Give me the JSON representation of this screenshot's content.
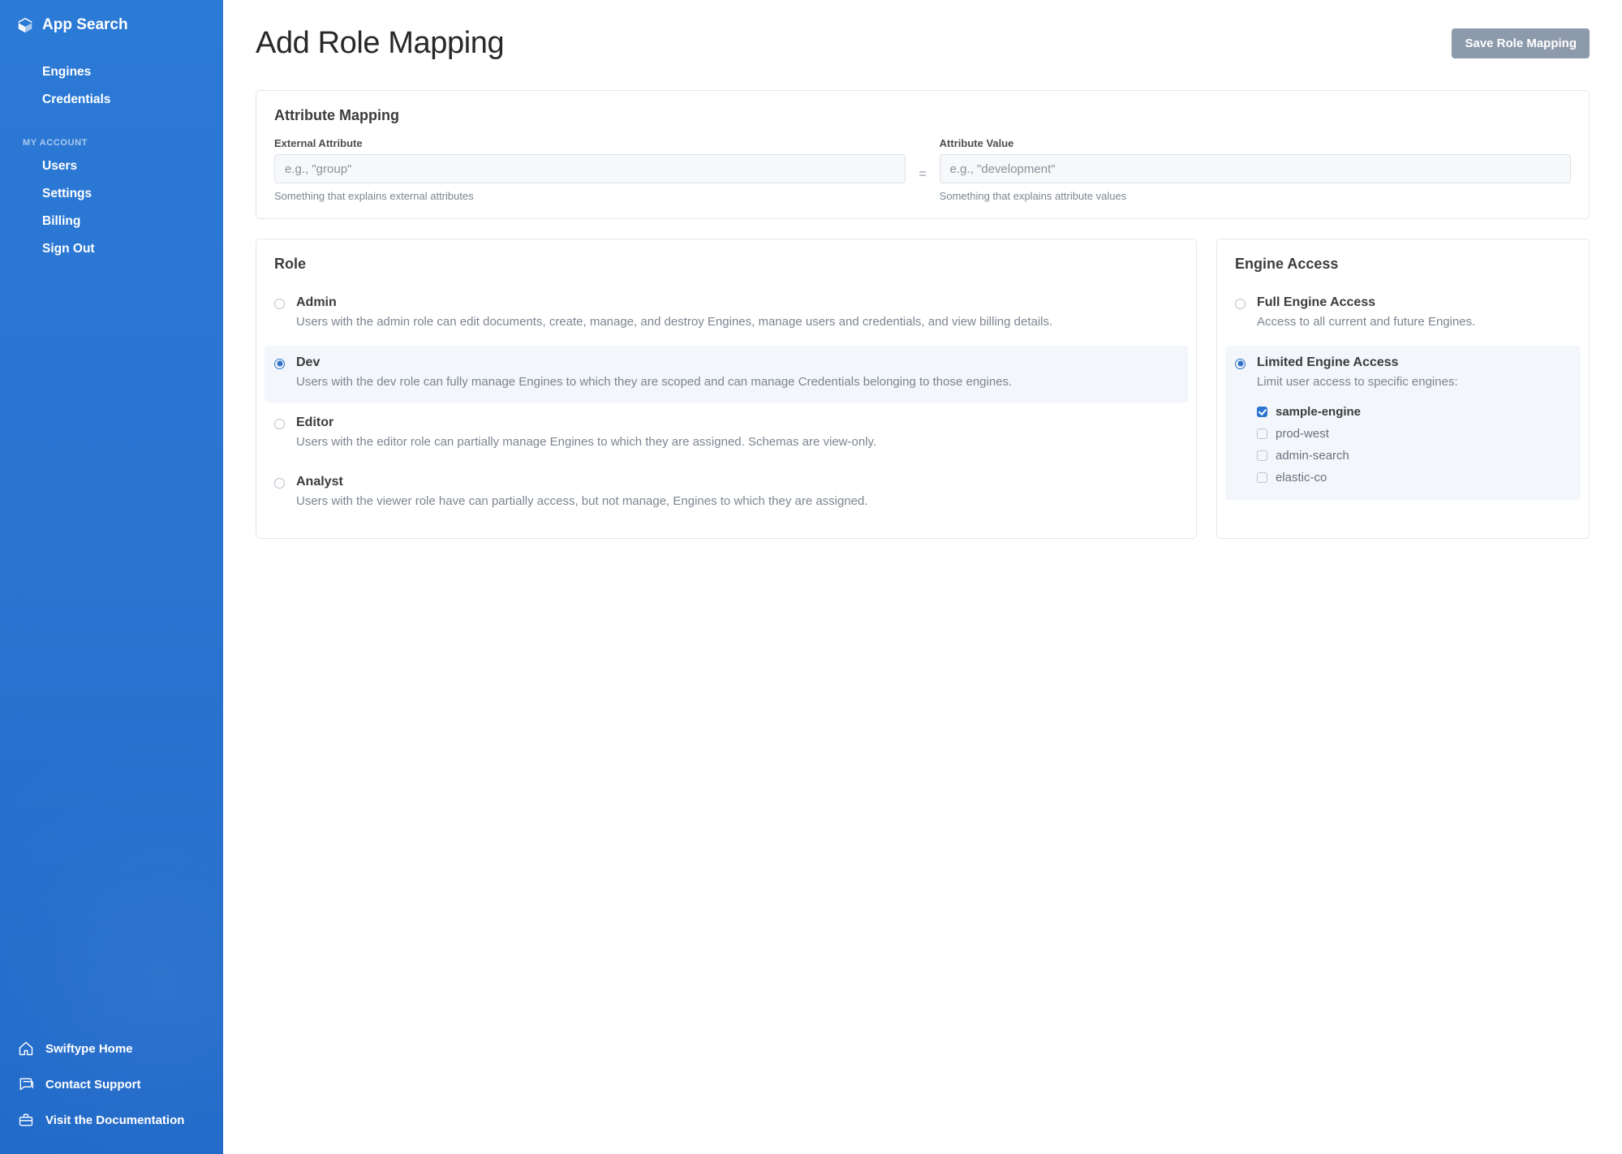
{
  "brand": {
    "title": "App Search"
  },
  "nav": {
    "primary": [
      {
        "label": "Engines"
      },
      {
        "label": "Credentials"
      }
    ],
    "account_label": "MY ACCOUNT",
    "account": [
      {
        "label": "Users"
      },
      {
        "label": "Settings"
      },
      {
        "label": "Billing"
      },
      {
        "label": "Sign Out"
      }
    ],
    "bottom": [
      {
        "label": "Swiftype Home",
        "icon": "home-icon"
      },
      {
        "label": "Contact Support",
        "icon": "chat-icon"
      },
      {
        "label": "Visit the Documentation",
        "icon": "briefcase-icon"
      }
    ]
  },
  "page": {
    "title": "Add Role Mapping",
    "save_button": "Save Role Mapping"
  },
  "attr_mapping": {
    "title": "Attribute Mapping",
    "external_label": "External Attribute",
    "external_placeholder": "e.g., \"group\"",
    "external_hint": "Something that explains external attributes",
    "equals": "=",
    "value_label": "Attribute Value",
    "value_placeholder": "e.g., \"development\"",
    "value_hint": "Something that explains attribute values"
  },
  "role": {
    "title": "Role",
    "options": [
      {
        "name": "Admin",
        "desc": "Users with the admin role can edit documents, create, manage, and destroy Engines, manage users and credentials, and view billing details.",
        "selected": false
      },
      {
        "name": "Dev",
        "desc": "Users with the dev role can fully manage Engines to which they are scoped and can manage Credentials belonging to those engines.",
        "selected": true
      },
      {
        "name": "Editor",
        "desc": "Users with the editor role can partially manage Engines to which they are assigned. Schemas are view-only.",
        "selected": false
      },
      {
        "name": "Analyst",
        "desc": "Users with the viewer role have can partially access, but not manage, Engines to which they are assigned.",
        "selected": false
      }
    ]
  },
  "engine_access": {
    "title": "Engine Access",
    "options": [
      {
        "name": "Full Engine Access",
        "desc": "Access to all current and future Engines.",
        "selected": false
      },
      {
        "name": "Limited Engine Access",
        "desc": "Limit user access to specific engines:",
        "selected": true
      }
    ],
    "engines": [
      {
        "label": "sample-engine",
        "checked": true
      },
      {
        "label": "prod-west",
        "checked": false
      },
      {
        "label": "admin-search",
        "checked": false
      },
      {
        "label": "elastic-co",
        "checked": false
      }
    ]
  }
}
